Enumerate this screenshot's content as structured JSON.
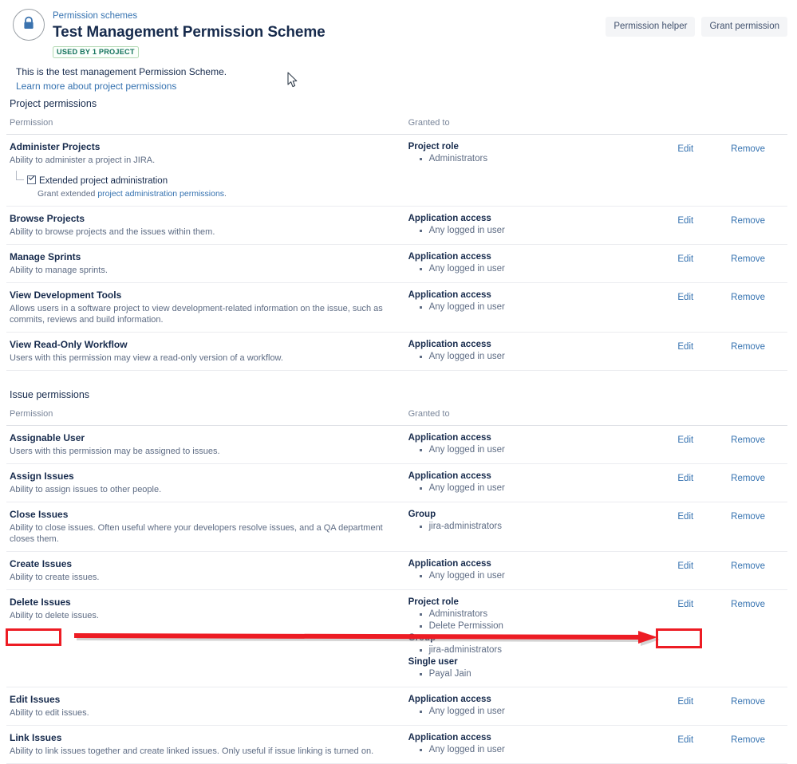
{
  "header": {
    "avatar_icon": "lock-icon",
    "breadcrumb": "Permission schemes",
    "title": "Test Management Permission Scheme",
    "usage_badge": "USED BY 1 PROJECT",
    "description": "This is the test management Permission Scheme.",
    "learn_more_link": "Learn more about project permissions",
    "buttons": {
      "permission_helper": "Permission helper",
      "grant_permission": "Grant permission"
    }
  },
  "columns": {
    "permission": "Permission",
    "granted_to": "Granted to"
  },
  "actions": {
    "edit": "Edit",
    "remove": "Remove"
  },
  "sections": [
    {
      "title": "Project permissions",
      "rows": [
        {
          "name": "Administer Projects",
          "description": "Ability to administer a project in JIRA.",
          "sub_option": {
            "checked": true,
            "label": "Extended project administration",
            "desc_prefix": "Grant extended ",
            "desc_link": "project administration permissions",
            "desc_suffix": "."
          },
          "granted": [
            {
              "type": "Project role",
              "items": [
                "Administrators"
              ]
            }
          ]
        },
        {
          "name": "Browse Projects",
          "description": "Ability to browse projects and the issues within them.",
          "granted": [
            {
              "type": "Application access",
              "items": [
                "Any logged in user"
              ]
            }
          ]
        },
        {
          "name": "Manage Sprints",
          "description": "Ability to manage sprints.",
          "granted": [
            {
              "type": "Application access",
              "items": [
                "Any logged in user"
              ]
            }
          ]
        },
        {
          "name": "View Development Tools",
          "description": "Allows users in a software project to view development-related information on the issue, such as commits, reviews and build information.",
          "granted": [
            {
              "type": "Application access",
              "items": [
                "Any logged in user"
              ]
            }
          ]
        },
        {
          "name": "View Read-Only Workflow",
          "description": "Users with this permission may view a read-only version of a workflow.",
          "granted": [
            {
              "type": "Application access",
              "items": [
                "Any logged in user"
              ]
            }
          ]
        }
      ]
    },
    {
      "title": "Issue permissions",
      "rows": [
        {
          "name": "Assignable User",
          "description": "Users with this permission may be assigned to issues.",
          "granted": [
            {
              "type": "Application access",
              "items": [
                "Any logged in user"
              ]
            }
          ]
        },
        {
          "name": "Assign Issues",
          "description": "Ability to assign issues to other people.",
          "granted": [
            {
              "type": "Application access",
              "items": [
                "Any logged in user"
              ]
            }
          ]
        },
        {
          "name": "Close Issues",
          "description": "Ability to close issues. Often useful where your developers resolve issues, and a QA department closes them.",
          "granted": [
            {
              "type": "Group",
              "items": [
                "jira-administrators"
              ]
            }
          ]
        },
        {
          "name": "Create Issues",
          "description": "Ability to create issues.",
          "granted": [
            {
              "type": "Application access",
              "items": [
                "Any logged in user"
              ]
            }
          ]
        },
        {
          "name": "Delete Issues",
          "description": "Ability to delete issues.",
          "granted": [
            {
              "type": "Project role",
              "items": [
                "Administrators",
                "Delete Permission"
              ]
            },
            {
              "type": "Group",
              "items": [
                "jira-administrators"
              ]
            },
            {
              "type": "Single user",
              "items": [
                "Payal Jain"
              ]
            }
          ]
        },
        {
          "name": "Edit Issues",
          "description": "Ability to edit issues.",
          "granted": [
            {
              "type": "Application access",
              "items": [
                "Any logged in user"
              ]
            }
          ]
        },
        {
          "name": "Link Issues",
          "description": "Ability to link issues together and create linked issues. Only useful if issue linking is turned on.",
          "granted": [
            {
              "type": "Application access",
              "items": [
                "Any logged in user"
              ]
            }
          ]
        }
      ]
    }
  ],
  "annotations": {
    "color": "#ed1c24",
    "highlight_source": "Link Issues",
    "highlight_target": "Edit"
  }
}
